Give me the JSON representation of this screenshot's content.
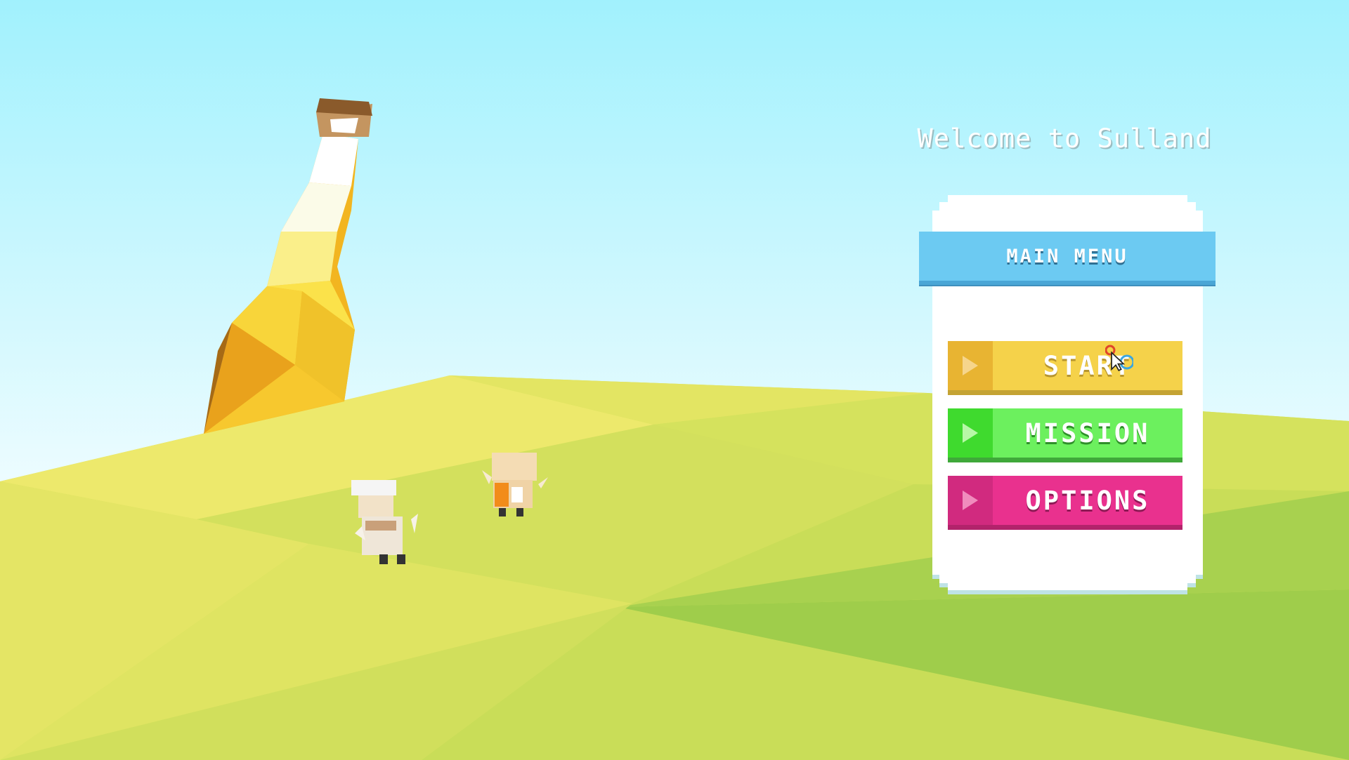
{
  "scene": {
    "sky_top": "#a1f1fd",
    "sky_bottom": "#e8fbff",
    "hill_colors": [
      "#f0ec6f",
      "#dde662",
      "#cde05b",
      "#a4cf4c"
    ]
  },
  "welcome_text": "Welcome to Sulland",
  "menu": {
    "title": "MAIN MENU",
    "buttons": [
      {
        "label": "START",
        "color": "#f5d24a",
        "icon": "play-triangle-icon"
      },
      {
        "label": "MISSION",
        "color": "#6cf05e",
        "icon": "play-triangle-icon"
      },
      {
        "label": "OPTIONS",
        "color": "#e9318e",
        "icon": "play-triangle-icon"
      }
    ]
  }
}
